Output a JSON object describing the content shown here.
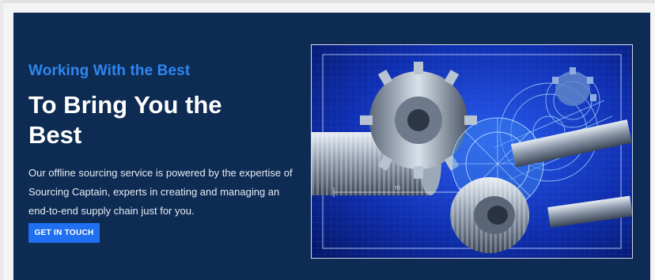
{
  "hero": {
    "eyebrow": "Working With the Best",
    "headline": "To Bring You the Best",
    "description": "Our offline sourcing service is powered by the expertise of Sourcing Captain, experts in creating and managing an end-to-end supply chain just for you.",
    "cta_label": "GET IN TOUCH",
    "image_dimension_label": "70"
  },
  "colors": {
    "background": "#0d2b53",
    "accent": "#2f86f0",
    "button": "#1f6ff0"
  }
}
